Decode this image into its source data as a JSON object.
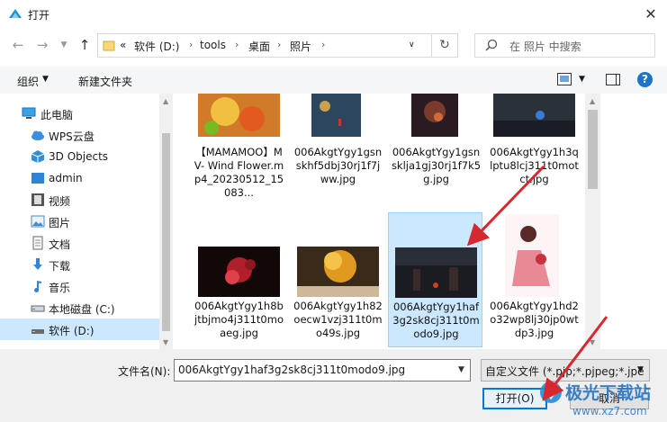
{
  "window": {
    "title": "打开"
  },
  "address": {
    "overflow": "«",
    "crumbs": [
      "软件 (D:)",
      "tools",
      "桌面",
      "照片"
    ]
  },
  "search": {
    "placeholder": "在 照片 中搜索"
  },
  "toolbar": {
    "organize": "组织",
    "new_folder": "新建文件夹"
  },
  "nav": {
    "items": [
      {
        "label": "此电脑",
        "icon": "computer-icon"
      },
      {
        "label": "WPS云盘",
        "icon": "cloud-icon"
      },
      {
        "label": "3D Objects",
        "icon": "3d-objects-icon"
      },
      {
        "label": "admin",
        "icon": "user-folder-icon"
      },
      {
        "label": "视频",
        "icon": "video-icon"
      },
      {
        "label": "图片",
        "icon": "picture-icon"
      },
      {
        "label": "文档",
        "icon": "document-icon"
      },
      {
        "label": "下载",
        "icon": "download-icon"
      },
      {
        "label": "音乐",
        "icon": "music-icon"
      },
      {
        "label": "本地磁盘 (C:)",
        "icon": "drive-icon"
      },
      {
        "label": "软件 (D:)",
        "icon": "drive-icon",
        "selected": true
      }
    ]
  },
  "files": [
    {
      "name": "【MAMAMOO】MV- Wind Flower.mp4_20230512_15083...",
      "selected": false
    },
    {
      "name": "006AkgtYgy1gsnskhf5dbj30rj1f7jww.jpg",
      "selected": false
    },
    {
      "name": "006AkgtYgy1gsnsklja1gj30rj1f7k5g.jpg",
      "selected": false
    },
    {
      "name": "006AkgtYgy1h3qlptu8lcj311t0motct.jpg",
      "selected": false
    },
    {
      "name": "006AkgtYgy1h8bjtbjmo4j311t0moaeg.jpg",
      "selected": false
    },
    {
      "name": "006AkgtYgy1h82oecw1vzj311t0mo49s.jpg",
      "selected": false
    },
    {
      "name": "006AkgtYgy1haf3g2sk8cj311t0modo9.jpg",
      "selected": true
    },
    {
      "name": "006AkgtYgy1hd2o32wp8lj30jp0wtdp3.jpg",
      "selected": false
    }
  ],
  "bottom": {
    "filename_label": "文件名(N):",
    "filename_value": "006AkgtYgy1haf3g2sk8cj311t0modo9.jpg",
    "filter_value": "自定义文件 (*.pjp;*.pjpeg;*.jpe",
    "open_label": "打开(O)",
    "cancel_label": "取消"
  },
  "watermark": {
    "text": "极光下载站",
    "url": "www.xz7.com"
  },
  "colors": {
    "selection": "#cce8ff",
    "accent": "#0078d7",
    "annotation_arrow": "#d7282f"
  }
}
